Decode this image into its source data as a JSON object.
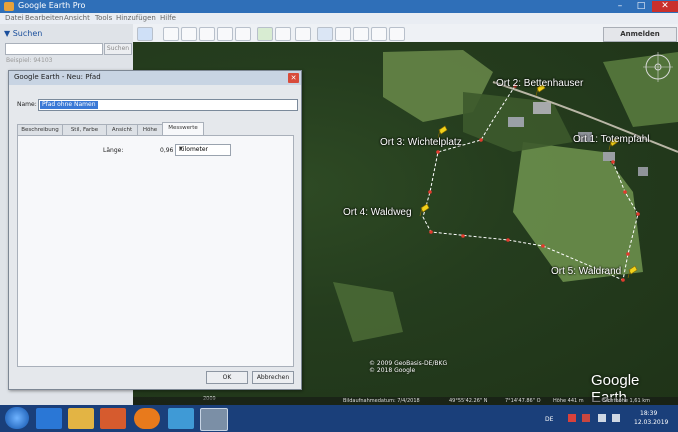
{
  "window": {
    "title": "Google Earth Pro"
  },
  "menu": {
    "items": [
      "Datei",
      "Bearbeiten",
      "Ansicht",
      "Tools",
      "Hinzufügen",
      "Hilfe"
    ]
  },
  "toolbar": {
    "signin_label": "Anmelden"
  },
  "left_panel": {
    "search_header": "▼ Suchen",
    "search_button": "Suchen",
    "search_value": "",
    "hint": "Beispiel: 94103"
  },
  "dialog": {
    "title": "Google Earth - Neu: Pfad",
    "name_label": "Name:",
    "name_value": "Pfad ohne Namen",
    "tabs": [
      "Beschreibung",
      "Stil, Farbe",
      "Ansicht",
      "Höhe",
      "Messwerte"
    ],
    "active_tab": "Messwerte",
    "length_label": "Länge:",
    "length_value": "0,96",
    "unit": "Kilometer",
    "ok_label": "OK",
    "cancel_label": "Abbrechen"
  },
  "map": {
    "places": [
      {
        "label": "Ort 2: Bettenhauser"
      },
      {
        "label": "Ort 1: Totempfahl"
      },
      {
        "label": "Ort 3: Wichtelplatz"
      },
      {
        "label": "Ort 4: Waldweg"
      },
      {
        "label": "Ort 5: Waldrand"
      }
    ],
    "credits": "© 2009 GeoBasis-DE/BKG\n© 2018 Google",
    "brand": "Google Earth",
    "history_year": "2009",
    "status": {
      "imagery_date": "Bildaufnahmedatum: 7/4/2018",
      "lat": "49°55'42.26\" N",
      "lon": "7°14'47.86\" O",
      "elevation": "Höhe  441 m",
      "eye_alt": "Sichthöhe  1,61 km"
    },
    "path_color": "#ffffff",
    "point_color": "#e23b2e",
    "pin_color": "#f2d21a"
  },
  "taskbar": {
    "tray_lang": "DE",
    "time": "18:39",
    "date": "12.03.2019"
  }
}
